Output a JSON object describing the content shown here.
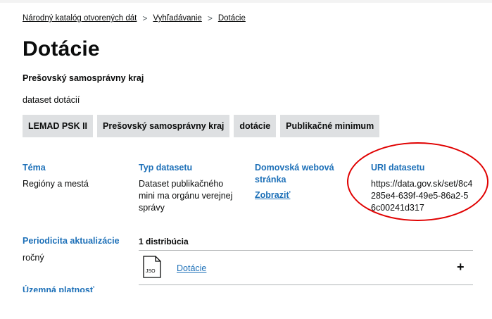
{
  "breadcrumb": [
    "Národný katalóg otvorených dát",
    "Vyhľadávanie",
    "Dotácie"
  ],
  "breadcrumb_separator": ">",
  "title": "Dotácie",
  "publisher": "Prešovský samosprávny kraj",
  "description": "dataset dotácií",
  "tags": [
    "LEMAD PSK II",
    "Prešovský samosprávny kraj",
    "dotácie",
    "Publikačné minimum"
  ],
  "info": {
    "tema": {
      "label": "Téma",
      "value": "Regióny a mestá"
    },
    "typ": {
      "label": "Typ datasetu",
      "value": "Dataset publikačného mini ma orgánu verejnej správy"
    },
    "web": {
      "label": "Domovská webová stránka",
      "link": "Zobraziť"
    },
    "uri": {
      "label": "URI datasetu",
      "value": "https://data.gov.sk/set/8c4285e4-639f-49e5-86a2-56c00241d317"
    }
  },
  "periodicity": {
    "label": "Periodicita aktualizácie",
    "value": "ročný"
  },
  "territorial": {
    "label": "Územná platnosť"
  },
  "distributions": {
    "count_label": "1 distribúcia",
    "items": [
      {
        "icon_text": "JSO",
        "name": "Dotácie",
        "expand": "+"
      }
    ]
  },
  "colors": {
    "accent": "#1d70b8",
    "annotation": "#e00000",
    "tag_bg": "#dee0e2"
  }
}
